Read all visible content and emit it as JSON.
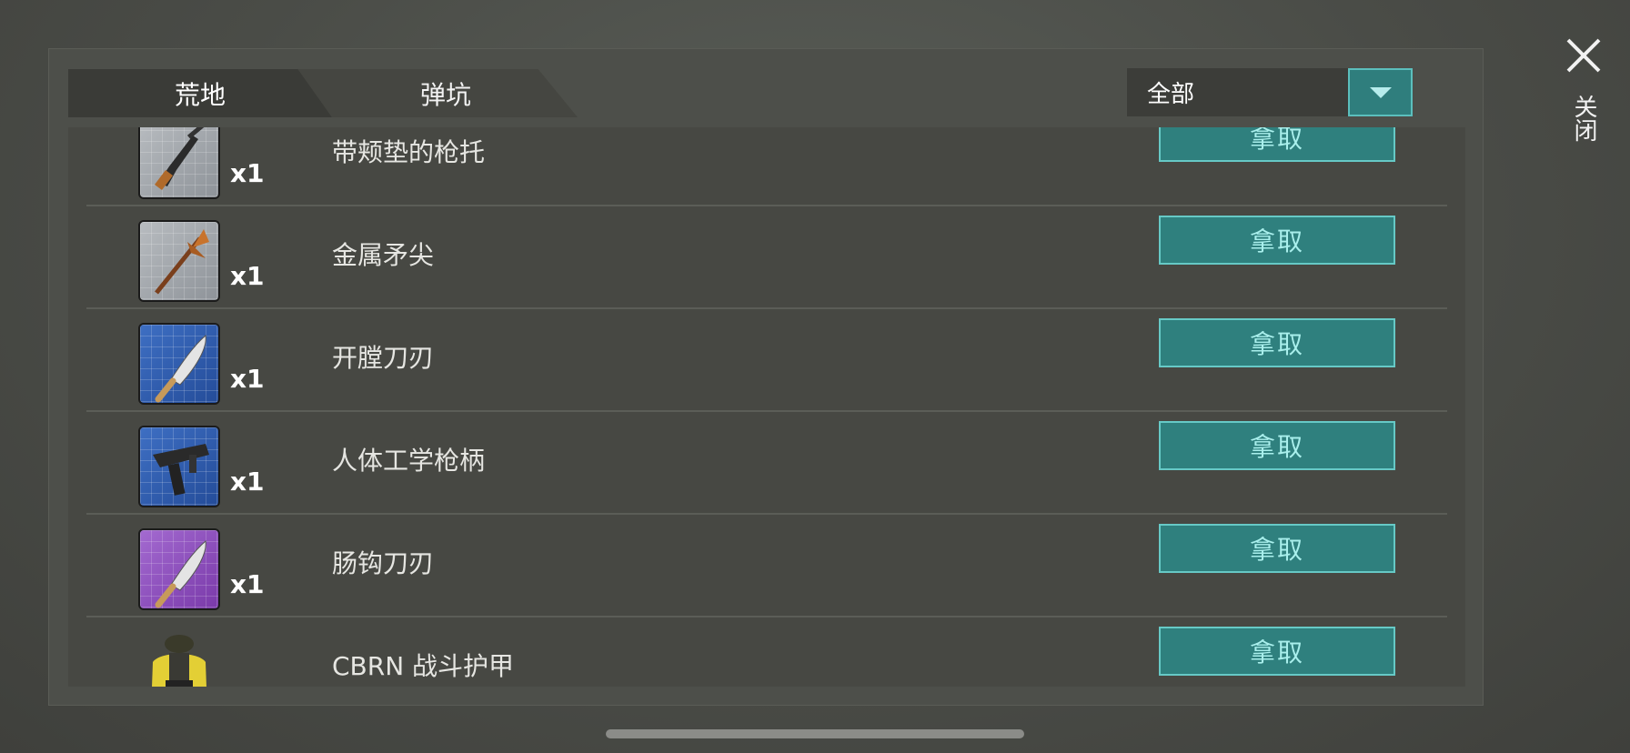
{
  "tabs": [
    {
      "label": "荒地",
      "active": true
    },
    {
      "label": "弹坑",
      "active": false
    }
  ],
  "filter": {
    "selected": "全部"
  },
  "close": {
    "label": "关闭"
  },
  "take_label": "拿取",
  "items": [
    {
      "name": "带颊垫的枪托",
      "qty": "x1",
      "rarity": "gray",
      "icon": "rifle-icon"
    },
    {
      "name": "金属矛尖",
      "qty": "x1",
      "rarity": "gray",
      "icon": "spear-icon"
    },
    {
      "name": "开膛刀刃",
      "qty": "x1",
      "rarity": "blue",
      "icon": "machete-icon"
    },
    {
      "name": "人体工学枪柄",
      "qty": "x1",
      "rarity": "blue",
      "icon": "smg-icon"
    },
    {
      "name": "肠钩刀刃",
      "qty": "x1",
      "rarity": "purple",
      "icon": "machete-icon"
    },
    {
      "name": "CBRN 战斗护甲",
      "qty": "",
      "rarity": "plain",
      "icon": "armor-icon"
    }
  ],
  "colors": {
    "accent": "#2f807e",
    "accent_border": "#66c9c6",
    "accent_text": "#a9efec"
  }
}
